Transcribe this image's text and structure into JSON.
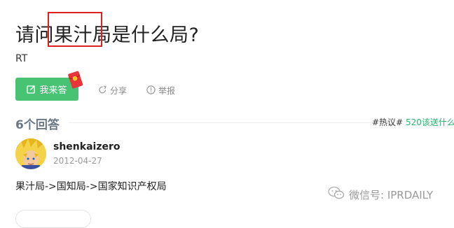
{
  "question": {
    "title": "请问果汁局是什么局?",
    "body": "RT"
  },
  "actions": {
    "answer_label": "我来答",
    "share_label": "分享",
    "report_label": "举报"
  },
  "answers": {
    "count_label": "6个回答",
    "hot_tag_prefix": "#热议#",
    "hot_tag_link": " 520该送什么礼"
  },
  "answer": {
    "username": "shenkaizero",
    "date": "2012-04-27",
    "text": "果汁局->国知局->国家知识产权局"
  },
  "watermark": {
    "label": "微信号: IPRDAILY"
  },
  "colors": {
    "accent_green": "#48c273",
    "link_green": "#2ab26d",
    "highlight_red": "#e02020"
  }
}
